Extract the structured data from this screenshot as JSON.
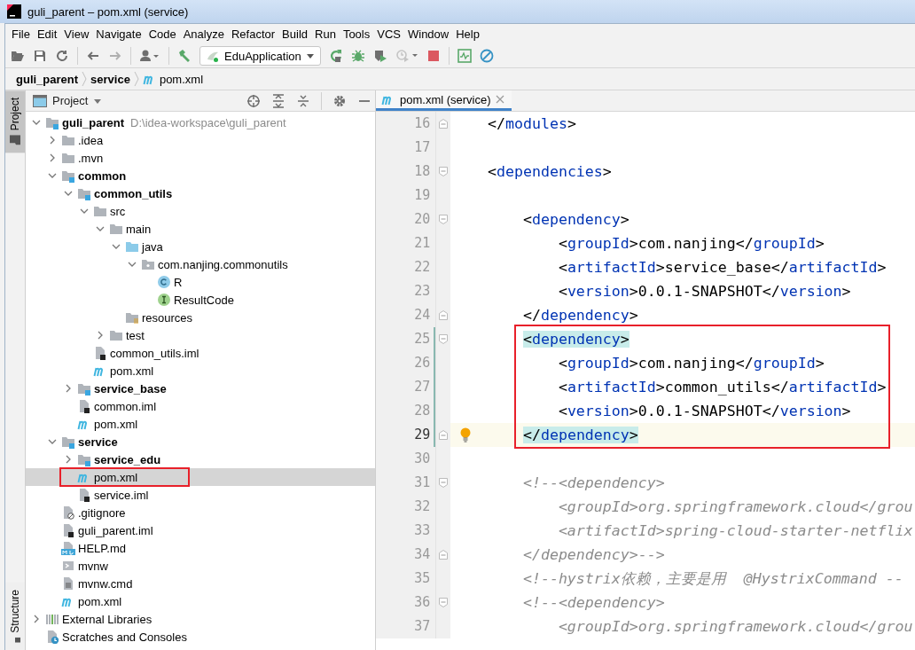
{
  "window": {
    "title": "guli_parent – pom.xml (service)"
  },
  "menu": [
    "File",
    "Edit",
    "View",
    "Navigate",
    "Code",
    "Analyze",
    "Refactor",
    "Build",
    "Run",
    "Tools",
    "VCS",
    "Window",
    "Help"
  ],
  "toolbar": {
    "run_configuration": "EduApplication"
  },
  "breadcrumbs": [
    {
      "label": "guli_parent",
      "kind": "module"
    },
    {
      "label": "service",
      "kind": "module"
    },
    {
      "label": "pom.xml",
      "kind": "pom"
    }
  ],
  "tool_strip": [
    {
      "label": "Project",
      "selected": true
    },
    {
      "label": "Structure",
      "selected": false
    }
  ],
  "project_panel": {
    "title": "Project",
    "tree": [
      {
        "label": "guli_parent",
        "kind": "module",
        "path": "D:\\idea-workspace\\guli_parent",
        "expanded": true,
        "selected": false,
        "boxed": false,
        "children": [
          {
            "label": ".idea",
            "kind": "folder",
            "expanded": false,
            "selected": false,
            "boxed": false
          },
          {
            "label": ".mvn",
            "kind": "folder",
            "expanded": false,
            "selected": false,
            "boxed": false
          },
          {
            "label": "common",
            "kind": "module",
            "expanded": true,
            "selected": false,
            "boxed": false,
            "children": [
              {
                "label": "common_utils",
                "kind": "module",
                "expanded": true,
                "selected": false,
                "boxed": false,
                "children": [
                  {
                    "label": "src",
                    "kind": "folder",
                    "expanded": true,
                    "selected": false,
                    "boxed": false,
                    "children": [
                      {
                        "label": "main",
                        "kind": "folder",
                        "expanded": true,
                        "selected": false,
                        "boxed": false,
                        "children": [
                          {
                            "label": "java",
                            "kind": "source-folder",
                            "expanded": true,
                            "selected": false,
                            "boxed": false,
                            "children": [
                              {
                                "label": "com.nanjing.commonutils",
                                "kind": "package",
                                "expanded": true,
                                "selected": false,
                                "boxed": false,
                                "children": [
                                  {
                                    "label": "R",
                                    "kind": "class",
                                    "selected": false,
                                    "boxed": false
                                  },
                                  {
                                    "label": "ResultCode",
                                    "kind": "interface",
                                    "selected": false,
                                    "boxed": false
                                  }
                                ]
                              }
                            ]
                          },
                          {
                            "label": "resources",
                            "kind": "resources-folder",
                            "selected": false,
                            "boxed": false
                          }
                        ]
                      },
                      {
                        "label": "test",
                        "kind": "folder",
                        "expanded": false,
                        "selected": false,
                        "boxed": false
                      }
                    ]
                  },
                  {
                    "label": "common_utils.iml",
                    "kind": "iml",
                    "selected": false,
                    "boxed": false
                  },
                  {
                    "label": "pom.xml",
                    "kind": "pom",
                    "selected": false,
                    "boxed": false
                  }
                ]
              },
              {
                "label": "service_base",
                "kind": "module",
                "expanded": false,
                "selected": false,
                "boxed": false
              },
              {
                "label": "common.iml",
                "kind": "iml",
                "selected": false,
                "boxed": false
              },
              {
                "label": "pom.xml",
                "kind": "pom",
                "selected": false,
                "boxed": false
              }
            ]
          },
          {
            "label": "service",
            "kind": "module",
            "expanded": true,
            "selected": false,
            "boxed": false,
            "children": [
              {
                "label": "service_edu",
                "kind": "module",
                "expanded": false,
                "selected": false,
                "boxed": false
              },
              {
                "label": "pom.xml",
                "kind": "pom",
                "selected": true,
                "boxed": true
              },
              {
                "label": "service.iml",
                "kind": "iml",
                "selected": false,
                "boxed": false
              }
            ]
          },
          {
            "label": ".gitignore",
            "kind": "gitignore",
            "selected": false,
            "boxed": false
          },
          {
            "label": "guli_parent.iml",
            "kind": "iml",
            "selected": false,
            "boxed": false
          },
          {
            "label": "HELP.md",
            "kind": "markdown",
            "selected": false,
            "boxed": false
          },
          {
            "label": "mvnw",
            "kind": "shell",
            "selected": false,
            "boxed": false
          },
          {
            "label": "mvnw.cmd",
            "kind": "text",
            "selected": false,
            "boxed": false
          },
          {
            "label": "pom.xml",
            "kind": "pom",
            "selected": false,
            "boxed": false
          }
        ]
      },
      {
        "label": "External Libraries",
        "kind": "libraries",
        "expanded": false,
        "selected": false,
        "boxed": false
      },
      {
        "label": "Scratches and Consoles",
        "kind": "scratches",
        "selected": false,
        "boxed": false
      }
    ]
  },
  "editor": {
    "tabs": [
      {
        "label": "pom.xml (service)",
        "kind": "pom",
        "selected": true
      }
    ],
    "lines": [
      {
        "number": "16",
        "kind": "fold-end",
        "current": false,
        "changed": false,
        "intention": false,
        "boxed": false,
        "segments": [
          {
            "kind": "punct",
            "text": "    </"
          },
          {
            "kind": "tag",
            "text": "modules"
          },
          {
            "kind": "punct",
            "text": ">"
          }
        ]
      },
      {
        "number": "17",
        "kind": "plain",
        "current": false,
        "changed": false,
        "intention": false,
        "boxed": false
      },
      {
        "number": "18",
        "kind": "fold-start",
        "current": false,
        "changed": false,
        "intention": false,
        "boxed": false,
        "segments": [
          {
            "kind": "punct",
            "text": "    <"
          },
          {
            "kind": "tag",
            "text": "dependencies"
          },
          {
            "kind": "punct",
            "text": ">"
          }
        ]
      },
      {
        "number": "19",
        "kind": "plain",
        "current": false,
        "changed": false,
        "intention": false,
        "boxed": false
      },
      {
        "number": "20",
        "kind": "fold-start",
        "current": false,
        "changed": false,
        "intention": false,
        "boxed": false,
        "segments": [
          {
            "kind": "punct",
            "text": "        <"
          },
          {
            "kind": "tag",
            "text": "dependency"
          },
          {
            "kind": "punct",
            "text": ">"
          }
        ]
      },
      {
        "number": "21",
        "kind": "plain",
        "current": false,
        "changed": false,
        "intention": false,
        "boxed": false,
        "segments": [
          {
            "kind": "punct",
            "text": "            <"
          },
          {
            "kind": "tag",
            "text": "groupId"
          },
          {
            "kind": "punct",
            "text": ">"
          },
          {
            "kind": "text",
            "text": "com.nanjing"
          },
          {
            "kind": "punct",
            "text": "</"
          },
          {
            "kind": "tag",
            "text": "groupId"
          },
          {
            "kind": "punct",
            "text": ">"
          }
        ]
      },
      {
        "number": "22",
        "kind": "plain",
        "current": false,
        "changed": false,
        "intention": false,
        "boxed": false,
        "segments": [
          {
            "kind": "punct",
            "text": "            <"
          },
          {
            "kind": "tag",
            "text": "artifactId"
          },
          {
            "kind": "punct",
            "text": ">"
          },
          {
            "kind": "text",
            "text": "service_base"
          },
          {
            "kind": "punct",
            "text": "</"
          },
          {
            "kind": "tag",
            "text": "artifactId"
          },
          {
            "kind": "punct",
            "text": ">"
          }
        ]
      },
      {
        "number": "23",
        "kind": "plain",
        "current": false,
        "changed": false,
        "intention": false,
        "boxed": false,
        "segments": [
          {
            "kind": "punct",
            "text": "            <"
          },
          {
            "kind": "tag",
            "text": "version"
          },
          {
            "kind": "punct",
            "text": ">"
          },
          {
            "kind": "text",
            "text": "0.0.1-SNAPSHOT"
          },
          {
            "kind": "punct",
            "text": "</"
          },
          {
            "kind": "tag",
            "text": "version"
          },
          {
            "kind": "punct",
            "text": ">"
          }
        ]
      },
      {
        "number": "24",
        "kind": "fold-end",
        "current": false,
        "changed": false,
        "intention": false,
        "boxed": false,
        "segments": [
          {
            "kind": "punct",
            "text": "        </"
          },
          {
            "kind": "tag",
            "text": "dependency"
          },
          {
            "kind": "punct",
            "text": ">"
          }
        ]
      },
      {
        "number": "25",
        "kind": "fold-start",
        "current": false,
        "changed": true,
        "intention": false,
        "boxed": true,
        "segments": [
          {
            "kind": "punct",
            "text": "        <",
            "matched": true
          },
          {
            "kind": "tag",
            "text": "dependency",
            "matched": true
          },
          {
            "kind": "punct",
            "text": ">",
            "matched": true
          }
        ]
      },
      {
        "number": "26",
        "kind": "plain",
        "current": false,
        "changed": true,
        "intention": false,
        "boxed": true,
        "segments": [
          {
            "kind": "punct",
            "text": "            <"
          },
          {
            "kind": "tag",
            "text": "groupId"
          },
          {
            "kind": "punct",
            "text": ">"
          },
          {
            "kind": "text",
            "text": "com.nanjing"
          },
          {
            "kind": "punct",
            "text": "</"
          },
          {
            "kind": "tag",
            "text": "groupId"
          },
          {
            "kind": "punct",
            "text": ">"
          }
        ]
      },
      {
        "number": "27",
        "kind": "plain",
        "current": false,
        "changed": true,
        "intention": false,
        "boxed": true,
        "segments": [
          {
            "kind": "punct",
            "text": "            <"
          },
          {
            "kind": "tag",
            "text": "artifactId"
          },
          {
            "kind": "punct",
            "text": ">"
          },
          {
            "kind": "text",
            "text": "common_utils"
          },
          {
            "kind": "punct",
            "text": "</"
          },
          {
            "kind": "tag",
            "text": "artifactId"
          },
          {
            "kind": "punct",
            "text": ">"
          }
        ]
      },
      {
        "number": "28",
        "kind": "plain",
        "current": false,
        "changed": true,
        "intention": false,
        "boxed": true,
        "segments": [
          {
            "kind": "punct",
            "text": "            <"
          },
          {
            "kind": "tag",
            "text": "version"
          },
          {
            "kind": "punct",
            "text": ">"
          },
          {
            "kind": "text",
            "text": "0.0.1-SNAPSHOT"
          },
          {
            "kind": "punct",
            "text": "</"
          },
          {
            "kind": "tag",
            "text": "version"
          },
          {
            "kind": "punct",
            "text": ">"
          }
        ]
      },
      {
        "number": "29",
        "kind": "fold-end",
        "current": true,
        "changed": true,
        "intention": true,
        "boxed": true,
        "segments": [
          {
            "kind": "punct",
            "text": "        </",
            "matched": true
          },
          {
            "kind": "tag",
            "text": "dependency",
            "matched": true
          },
          {
            "kind": "punct",
            "text": ">",
            "matched": true
          }
        ]
      },
      {
        "number": "30",
        "kind": "plain",
        "current": false,
        "changed": false,
        "intention": false,
        "boxed": false
      },
      {
        "number": "31",
        "kind": "fold-start",
        "current": false,
        "changed": false,
        "intention": false,
        "boxed": false,
        "segments": [
          {
            "kind": "comment",
            "text": "        <!--<dependency>"
          }
        ]
      },
      {
        "number": "32",
        "kind": "plain",
        "current": false,
        "changed": false,
        "intention": false,
        "boxed": false,
        "segments": [
          {
            "kind": "comment",
            "text": "            <groupId>org.springframework.cloud</grou"
          }
        ]
      },
      {
        "number": "33",
        "kind": "plain",
        "current": false,
        "changed": false,
        "intention": false,
        "boxed": false,
        "segments": [
          {
            "kind": "comment",
            "text": "            <artifactId>spring-cloud-starter-netflix"
          }
        ]
      },
      {
        "number": "34",
        "kind": "fold-end",
        "current": false,
        "changed": false,
        "intention": false,
        "boxed": false,
        "segments": [
          {
            "kind": "comment",
            "text": "        </dependency>-->"
          }
        ]
      },
      {
        "number": "35",
        "kind": "plain",
        "current": false,
        "changed": false,
        "intention": false,
        "boxed": false,
        "segments": [
          {
            "kind": "comment",
            "text": "        <!--hystrix依赖，主要是用  @HystrixCommand --"
          }
        ]
      },
      {
        "number": "36",
        "kind": "fold-start",
        "current": false,
        "changed": false,
        "intention": false,
        "boxed": false,
        "segments": [
          {
            "kind": "comment",
            "text": "        <!--<dependency>"
          }
        ]
      },
      {
        "number": "37",
        "kind": "plain",
        "current": false,
        "changed": false,
        "intention": false,
        "boxed": false,
        "segments": [
          {
            "kind": "comment",
            "text": "            <groupId>org.springframework.cloud</grou"
          }
        ]
      }
    ]
  }
}
